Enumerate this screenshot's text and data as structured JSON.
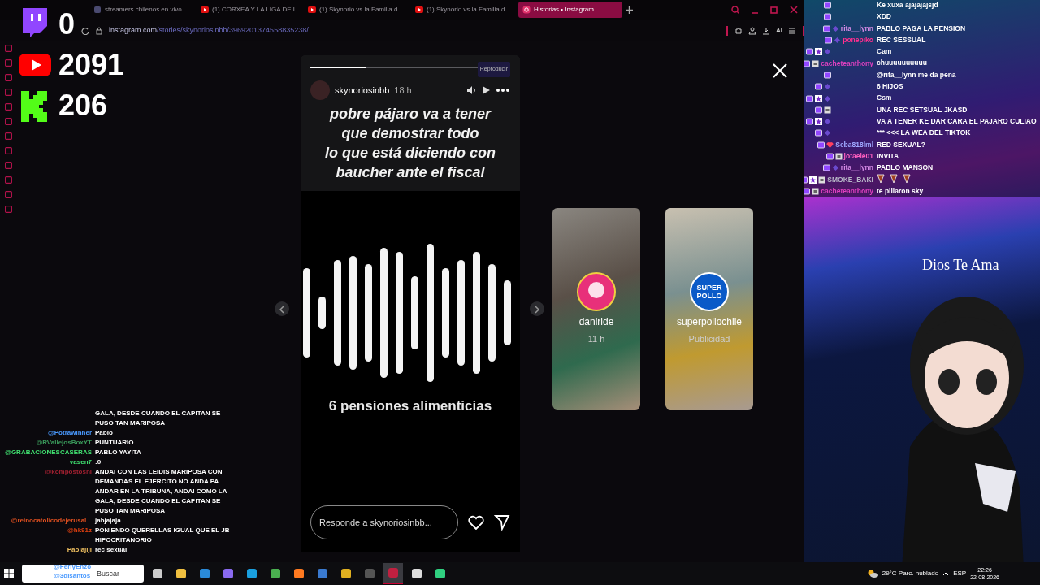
{
  "counters": [
    {
      "kind": "twitch",
      "value": "0"
    },
    {
      "kind": "youtube",
      "value": "2091"
    },
    {
      "kind": "kick",
      "value": "206"
    }
  ],
  "browser": {
    "tabs": [
      {
        "label": "streamers chilenos en vivo",
        "kind": "app",
        "selected": false
      },
      {
        "label": "(1) CORXEA Y LA LIGA DE L",
        "kind": "youtube",
        "selected": false
      },
      {
        "label": "(1) Skynorio vs la Familia d",
        "kind": "youtube",
        "selected": false
      },
      {
        "label": "(1) Skynorio vs la Familia d",
        "kind": "youtube",
        "selected": false
      },
      {
        "label": "Historias • Instagram",
        "kind": "instagram",
        "selected": true
      }
    ],
    "address": {
      "host": "instagram.com",
      "path": "/stories/skynoriosinbb/3969201374558835238/"
    },
    "toolbar_labels": [
      "AI"
    ]
  },
  "story": {
    "progress": {
      "level": 0.28
    },
    "username": "skynoriosinbb",
    "time": "18 h",
    "tooltip": "Reproducir",
    "caption": [
      "pobre pájaro va a tener",
      "que demostrar todo",
      "lo que está diciendo con",
      "baucher ante el fiscal"
    ],
    "bottom_text": "6 pensiones alimenticias",
    "reply": {
      "placeholder": "Responde a skynoriosinbb..."
    }
  },
  "suggested": [
    {
      "name": "daniride",
      "meta": "11 h",
      "kind": "person"
    },
    {
      "name": "superpollochile",
      "meta": "Publicidad",
      "kind": "brand",
      "brand_text": "SUPER POLLO"
    }
  ],
  "right_chat": [
    {
      "badges": [
        {
          "kind": "twitch"
        }
      ],
      "message": "Ke xuxa ajajajajsjd"
    },
    {
      "badges": [
        {
          "kind": "twitch"
        }
      ],
      "message": "XDD"
    },
    {
      "badges": [
        {
          "kind": "twitch"
        },
        {
          "kind": "emote"
        }
      ],
      "name": "rita__lynn",
      "color": "#d58ae6",
      "message": "PABLO PAGA LA PENSION"
    },
    {
      "badges": [
        {
          "kind": "twitch"
        },
        {
          "kind": "emote"
        }
      ],
      "name": "ponepiko",
      "color": "#ff2f8f",
      "message": "REC SESSUAL"
    },
    {
      "badges": [
        {
          "kind": "twitch"
        },
        {
          "kind": "star"
        },
        {
          "kind": "emote"
        }
      ],
      "message": "Cam"
    },
    {
      "badges": [
        {
          "kind": "twitch"
        },
        {
          "kind": "box"
        }
      ],
      "name": "cacheteanthony",
      "color": "#e040c0",
      "message": "chuuuuuuuuuu"
    },
    {
      "badges": [
        {
          "kind": "twitch"
        }
      ],
      "message": "@rita__lynn me da pena"
    },
    {
      "badges": [
        {
          "kind": "twitch"
        },
        {
          "kind": "emote"
        }
      ],
      "message": "6 HIJOS"
    },
    {
      "badges": [
        {
          "kind": "twitch"
        },
        {
          "kind": "star"
        },
        {
          "kind": "emote"
        }
      ],
      "message": "Csm"
    },
    {
      "badges": [
        {
          "kind": "twitch"
        },
        {
          "kind": "box"
        }
      ],
      "message": "UNA REC SETSUAL JKASD"
    },
    {
      "badges": [
        {
          "kind": "twitch"
        },
        {
          "kind": "star"
        },
        {
          "kind": "emote"
        }
      ],
      "message": "VA A TENER KE DAR CARA EL PAJARO CULIAO"
    },
    {
      "badges": [
        {
          "kind": "twitch"
        },
        {
          "kind": "emote"
        }
      ],
      "message": "*** <<< LA WEA DEL TIKTOK"
    },
    {
      "badges": [
        {
          "kind": "twitch"
        },
        {
          "kind": "heart"
        }
      ],
      "name": "Seba818lml",
      "color": "#9fa8ff",
      "message": "RED SEXUAL?"
    },
    {
      "badges": [
        {
          "kind": "twitch"
        },
        {
          "kind": "box"
        }
      ],
      "name": "jotaele01",
      "color": "#ff5fc0",
      "message": "INVITA"
    },
    {
      "badges": [
        {
          "kind": "twitch"
        },
        {
          "kind": "emote"
        }
      ],
      "name": "rita__lynn",
      "color": "#d58ae6",
      "message": "PABLO MANSON"
    },
    {
      "badges": [
        {
          "kind": "twitch"
        },
        {
          "kind": "star"
        },
        {
          "kind": "box"
        }
      ],
      "name": "SMOKE_BAKI",
      "color": "#b8b8c8",
      "emotes": [
        {
          "kind": "emote"
        },
        {
          "kind": "emote"
        },
        {
          "kind": "emote"
        }
      ]
    },
    {
      "badges": [
        {
          "kind": "twitch"
        },
        {
          "kind": "box"
        }
      ],
      "name": "cacheteanthony",
      "color": "#e040c0",
      "message": "te pillaron sky"
    }
  ],
  "left_chat": [
    {
      "message": "GALA, DESDE CUANDO EL CAPITAN SE PUSO TAN MARIPOSA"
    },
    {
      "name": "@Potrawinner",
      "color": "#4a9aff",
      "message": "Pablo"
    },
    {
      "name": "@RVallejosBoxYT",
      "color": "#3a9a5a",
      "message": "PUNTUARIO"
    },
    {
      "name": "@GRABACIONESCASERAS",
      "color": "#40e070",
      "message": "PABLO YAYITA"
    },
    {
      "name": "vasen7",
      "color": "#40e070",
      "message": ":0"
    },
    {
      "name": "@kompostoshi",
      "color": "#a02030",
      "message": "ANDAI CON LAS LEIDIS MARIPOSA CON DEMANDAS EL EJERCITO NO ANDA PA ANDAR EN LA TRIBUNA, ANDAI COMO LA GALA, DESDE CUANDO EL CAPITAN SE PUSO TAN MARIPOSA"
    },
    {
      "name": "@reinocatolicodejerusal...",
      "color": "#e05020",
      "message": "jahjajaja"
    },
    {
      "name": "@hk91z",
      "color": "#e04010",
      "message": "PONIENDO QUERELLAS IGUAL QUE EL JB HIPOCRITANORIO"
    },
    {
      "name": "Paolajiji",
      "color": "#f0c060",
      "message": "rec sexual"
    }
  ],
  "overlay_names": [
    {
      "name": "@FerlyEnzo",
      "color": "#4a9aff"
    },
    {
      "name": "@3disantos",
      "color": "#4a9aff"
    }
  ],
  "banner_text": "Dios Te Ama",
  "taskbar": {
    "search": {
      "placeholder": "Buscar"
    },
    "apps": [
      {
        "kind": "taskview",
        "selected": false
      },
      {
        "kind": "folder",
        "selected": false
      },
      {
        "kind": "vscode",
        "selected": false
      },
      {
        "kind": "game",
        "selected": false
      },
      {
        "kind": "edge",
        "selected": false
      },
      {
        "kind": "leaf",
        "selected": false
      },
      {
        "kind": "firefox",
        "selected": false
      },
      {
        "kind": "vi",
        "selected": false
      },
      {
        "kind": "chrome",
        "selected": false
      },
      {
        "kind": "obs",
        "selected": false
      },
      {
        "kind": "target",
        "selected": true
      },
      {
        "kind": "portrait",
        "selected": false
      },
      {
        "kind": "chat",
        "selected": false
      }
    ],
    "weather": "29°C  Parc. nublado",
    "language": "ESP",
    "time": "22:26",
    "date": "22-08-2026"
  }
}
